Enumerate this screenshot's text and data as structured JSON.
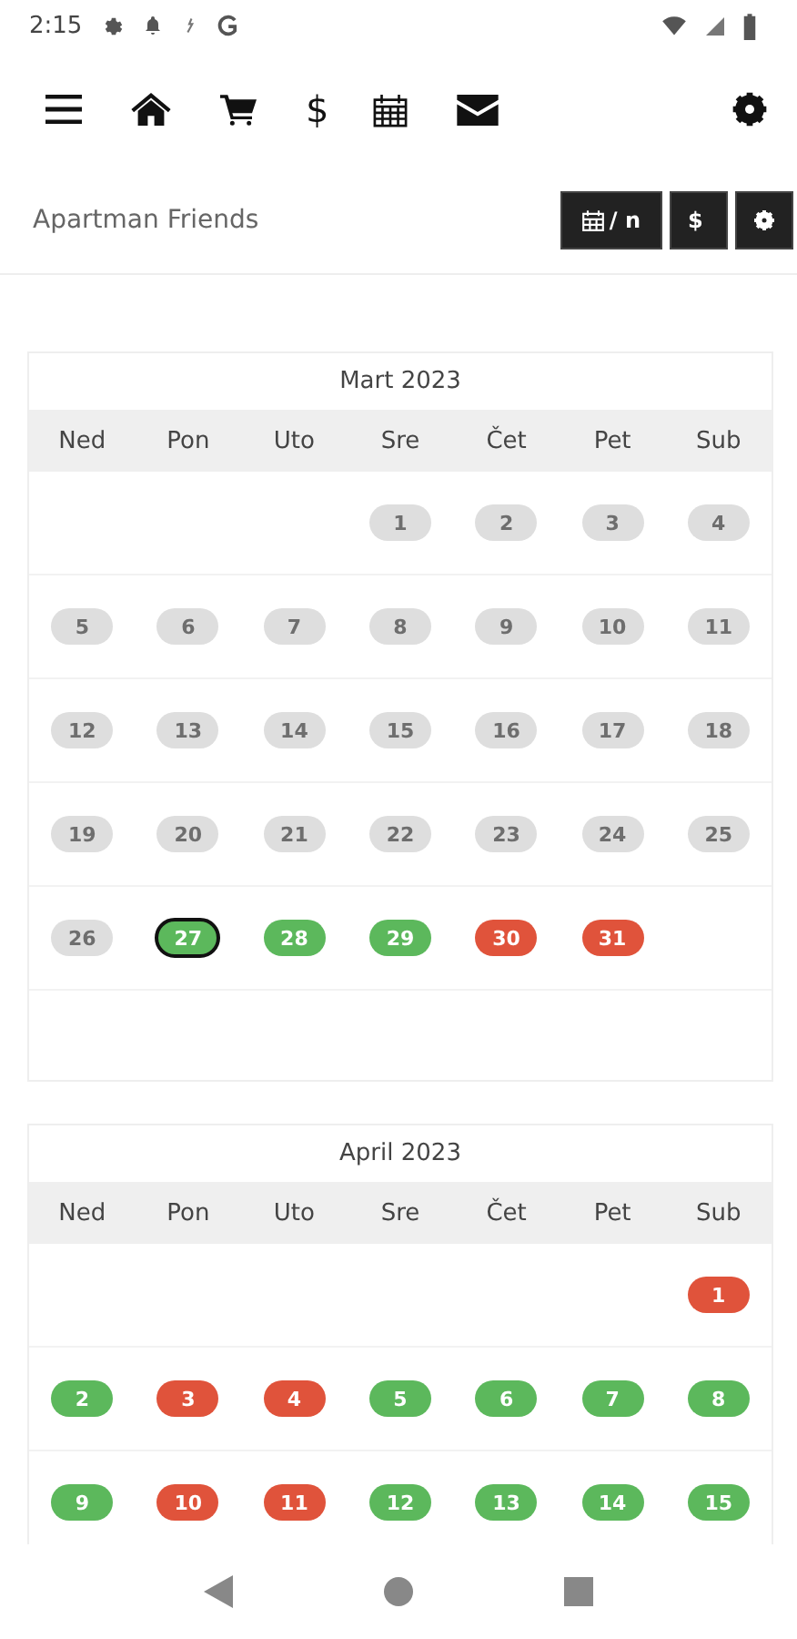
{
  "status_bar": {
    "time": "2:15"
  },
  "toolbar": {
    "dollar": "$"
  },
  "header": {
    "title": "Apartman Friends",
    "buttons": [
      {
        "kind": "calendar",
        "label": "/ n"
      },
      {
        "kind": "price",
        "label": "$"
      },
      {
        "kind": "settings"
      }
    ]
  },
  "months": [
    {
      "title": "Mart 2023",
      "weekdays": [
        "Ned",
        "Pon",
        "Uto",
        "Sre",
        "Čet",
        "Pet",
        "Sub"
      ],
      "weeks": [
        [
          {
            "kind": "empty"
          },
          {
            "kind": "empty"
          },
          {
            "kind": "empty"
          },
          {
            "kind": "past",
            "day": "1",
            "selected": false
          },
          {
            "kind": "past",
            "day": "2",
            "selected": false
          },
          {
            "kind": "past",
            "day": "3",
            "selected": false
          },
          {
            "kind": "past",
            "day": "4",
            "selected": false
          }
        ],
        [
          {
            "kind": "past",
            "day": "5",
            "selected": false
          },
          {
            "kind": "past",
            "day": "6",
            "selected": false
          },
          {
            "kind": "past",
            "day": "7",
            "selected": false
          },
          {
            "kind": "past",
            "day": "8",
            "selected": false
          },
          {
            "kind": "past",
            "day": "9",
            "selected": false
          },
          {
            "kind": "past",
            "day": "10",
            "selected": false
          },
          {
            "kind": "past",
            "day": "11",
            "selected": false
          }
        ],
        [
          {
            "kind": "past",
            "day": "12",
            "selected": false
          },
          {
            "kind": "past",
            "day": "13",
            "selected": false
          },
          {
            "kind": "past",
            "day": "14",
            "selected": false
          },
          {
            "kind": "past",
            "day": "15",
            "selected": false
          },
          {
            "kind": "past",
            "day": "16",
            "selected": false
          },
          {
            "kind": "past",
            "day": "17",
            "selected": false
          },
          {
            "kind": "past",
            "day": "18",
            "selected": false
          }
        ],
        [
          {
            "kind": "past",
            "day": "19",
            "selected": false
          },
          {
            "kind": "past",
            "day": "20",
            "selected": false
          },
          {
            "kind": "past",
            "day": "21",
            "selected": false
          },
          {
            "kind": "past",
            "day": "22",
            "selected": false
          },
          {
            "kind": "past",
            "day": "23",
            "selected": false
          },
          {
            "kind": "past",
            "day": "24",
            "selected": false
          },
          {
            "kind": "past",
            "day": "25",
            "selected": false
          }
        ],
        [
          {
            "kind": "past",
            "day": "26",
            "selected": false
          },
          {
            "kind": "free",
            "day": "27",
            "selected": true
          },
          {
            "kind": "free",
            "day": "28",
            "selected": false
          },
          {
            "kind": "free",
            "day": "29",
            "selected": false
          },
          {
            "kind": "booked",
            "day": "30",
            "selected": false
          },
          {
            "kind": "booked",
            "day": "31",
            "selected": false
          },
          {
            "kind": "empty"
          }
        ]
      ]
    },
    {
      "title": "April 2023",
      "weekdays": [
        "Ned",
        "Pon",
        "Uto",
        "Sre",
        "Čet",
        "Pet",
        "Sub"
      ],
      "weeks": [
        [
          {
            "kind": "empty"
          },
          {
            "kind": "empty"
          },
          {
            "kind": "empty"
          },
          {
            "kind": "empty"
          },
          {
            "kind": "empty"
          },
          {
            "kind": "empty"
          },
          {
            "kind": "booked",
            "day": "1",
            "selected": false
          }
        ],
        [
          {
            "kind": "free",
            "day": "2",
            "selected": false
          },
          {
            "kind": "booked",
            "day": "3",
            "selected": false
          },
          {
            "kind": "booked",
            "day": "4",
            "selected": false
          },
          {
            "kind": "free",
            "day": "5",
            "selected": false
          },
          {
            "kind": "free",
            "day": "6",
            "selected": false
          },
          {
            "kind": "free",
            "day": "7",
            "selected": false
          },
          {
            "kind": "free",
            "day": "8",
            "selected": false
          }
        ],
        [
          {
            "kind": "free",
            "day": "9",
            "selected": false
          },
          {
            "kind": "booked",
            "day": "10",
            "selected": false
          },
          {
            "kind": "booked",
            "day": "11",
            "selected": false
          },
          {
            "kind": "free",
            "day": "12",
            "selected": false
          },
          {
            "kind": "free",
            "day": "13",
            "selected": false
          },
          {
            "kind": "free",
            "day": "14",
            "selected": false
          },
          {
            "kind": "free",
            "day": "15",
            "selected": false
          }
        ]
      ]
    }
  ]
}
